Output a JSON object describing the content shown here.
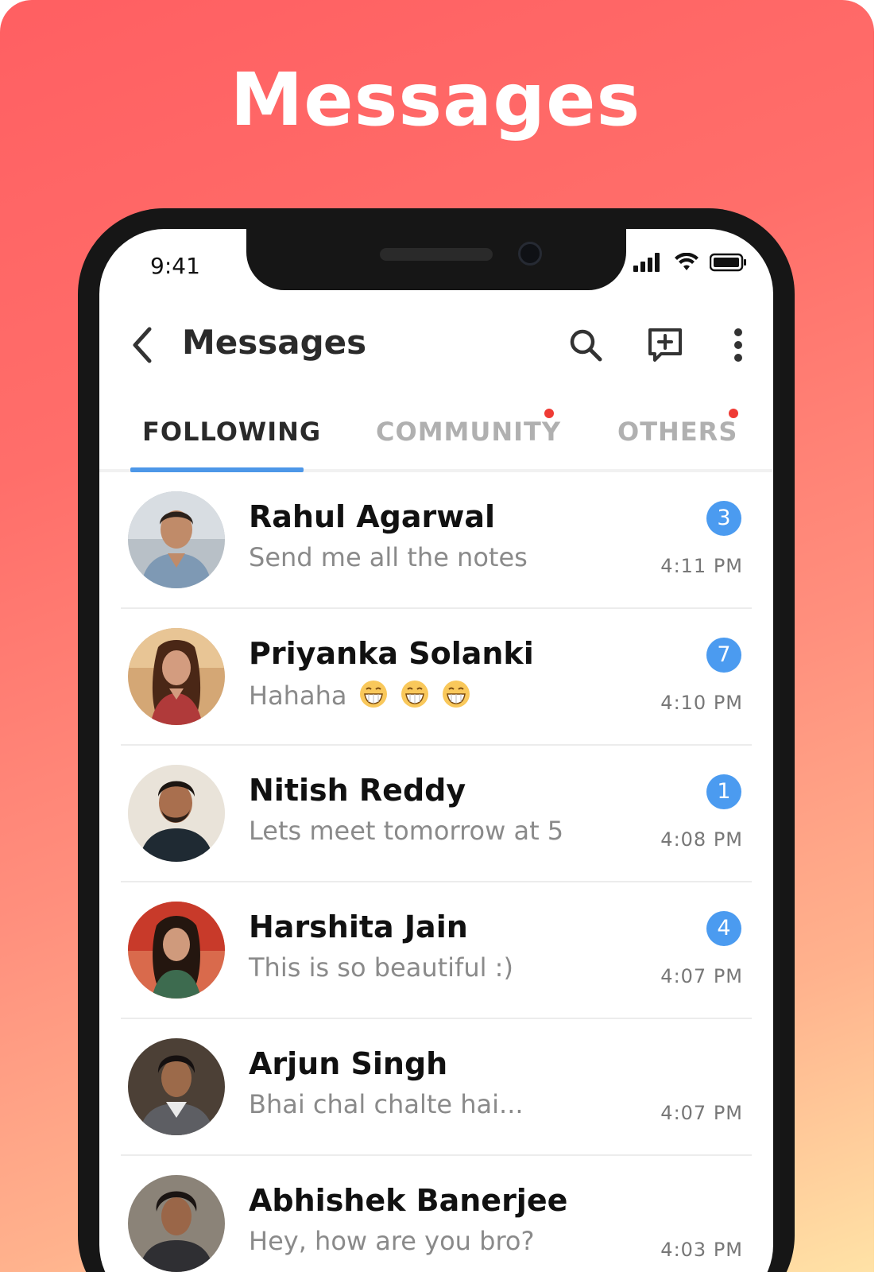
{
  "hero": {
    "title": "Messages"
  },
  "status_bar": {
    "time": "9:41"
  },
  "app_bar": {
    "title": "Messages",
    "actions": [
      "search-icon",
      "new-message-icon",
      "more-vertical-icon"
    ]
  },
  "tabs": [
    {
      "label": "FOLLOWING",
      "active": true,
      "has_dot": false
    },
    {
      "label": "COMMUNITY",
      "active": false,
      "has_dot": true
    },
    {
      "label": "OTHERS",
      "active": false,
      "has_dot": true
    }
  ],
  "conversations": [
    {
      "name": "Rahul Agarwal",
      "message": "Send me all the notes",
      "time": "4:11 PM",
      "unread": "3"
    },
    {
      "name": "Priyanka Solanki",
      "message": "Hahaha",
      "time": "4:10 PM",
      "unread": "7"
    },
    {
      "name": "Nitish Reddy",
      "message": "Lets meet tomorrow at 5",
      "time": "4:08 PM",
      "unread": "1"
    },
    {
      "name": "Harshita Jain",
      "message": "This is so beautiful :)",
      "time": "4:07 PM",
      "unread": "4"
    },
    {
      "name": "Arjun Singh",
      "message": "Bhai chal chalte hai...",
      "time": "4:07 PM",
      "unread": ""
    },
    {
      "name": "Abhishek Banerjee",
      "message": "Hey, how are you bro?",
      "time": "4:03 PM",
      "unread": ""
    }
  ],
  "colors": {
    "accent": "#4d97e8",
    "badge": "#4b9bf0",
    "notification_dot": "#ef3b35",
    "background_top": "#ff5f62",
    "background_bottom": "#ffe2a6"
  }
}
